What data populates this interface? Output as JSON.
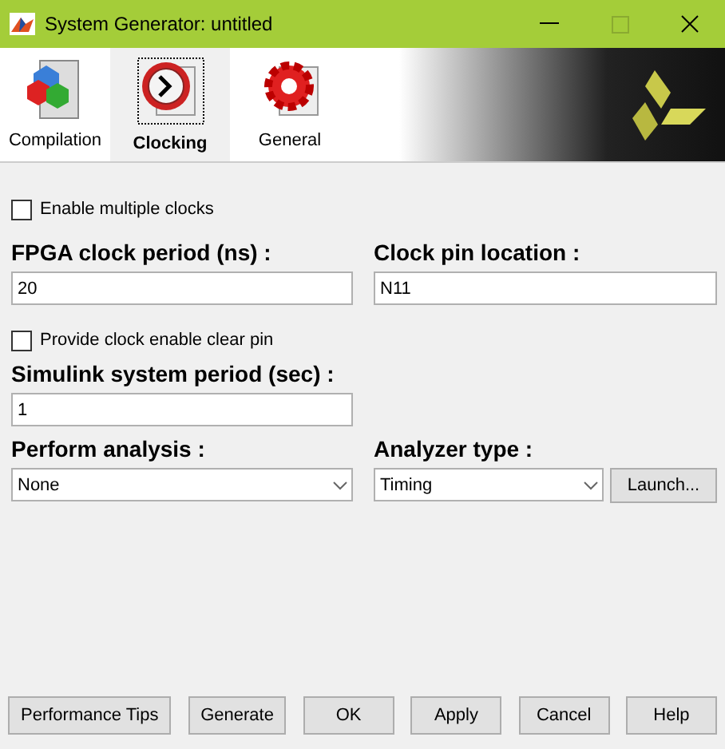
{
  "window": {
    "title": "System Generator: untitled"
  },
  "tabs": [
    {
      "label": "Compilation",
      "selected": false,
      "kind": "compilation"
    },
    {
      "label": "Clocking",
      "selected": true,
      "kind": "clocking"
    },
    {
      "label": "General",
      "selected": false,
      "kind": "general"
    }
  ],
  "enable_multiple_clocks": {
    "label": "Enable multiple clocks",
    "checked": false
  },
  "fpga_clock_period": {
    "label": "FPGA clock period (ns) :",
    "value": "20"
  },
  "clock_pin_location": {
    "label": "Clock pin location :",
    "value": "N11"
  },
  "provide_clock_enable_clear_pin": {
    "label": "Provide clock enable clear pin",
    "checked": false
  },
  "simulink_system_period": {
    "label": "Simulink system period (sec) :",
    "value": "1"
  },
  "perform_analysis": {
    "label": "Perform analysis :",
    "value": "None"
  },
  "analyzer_type": {
    "label": "Analyzer type :",
    "value": "Timing"
  },
  "launch_button": "Launch...",
  "buttons": [
    "Performance Tips",
    "Generate",
    "OK",
    "Apply",
    "Cancel",
    "Help"
  ]
}
